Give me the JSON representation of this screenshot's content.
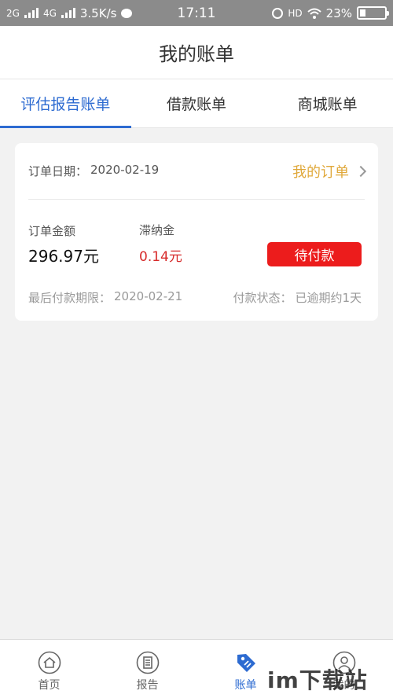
{
  "status_bar": {
    "net1": "2G",
    "net2": "4G",
    "speed": "3.5K/s",
    "time": "17:11",
    "hd": "HD",
    "battery": "23%"
  },
  "header": {
    "title": "我的账单"
  },
  "tabs": [
    {
      "label": "评估报告账单",
      "active": true
    },
    {
      "label": "借款账单",
      "active": false
    },
    {
      "label": "商城账单",
      "active": false
    }
  ],
  "card": {
    "order_date_label": "订单日期：",
    "order_date": "2020-02-19",
    "my_orders_label": "我的订单",
    "amount_label": "订单金额",
    "amount_value": "296.97元",
    "late_fee_label": "滞纳金",
    "late_fee_value": "0.14元",
    "pay_button": "待付款",
    "deadline_label": "最后付款期限：",
    "deadline": "2020-02-21",
    "status_label": "付款状态：",
    "status_value": "已逾期约1天"
  },
  "bottom_nav": [
    {
      "label": "首页",
      "icon": "home-icon"
    },
    {
      "label": "报告",
      "icon": "report-icon"
    },
    {
      "label": "账单",
      "icon": "bill-tag-icon",
      "active": true
    },
    {
      "label": "我的",
      "icon": "profile-icon"
    }
  ],
  "watermark": "im下载站",
  "colors": {
    "accent": "#2d6bd1",
    "pay_button": "#ec1c1c",
    "my_orders": "#e0a83a",
    "late_fee": "#d62a2a"
  }
}
